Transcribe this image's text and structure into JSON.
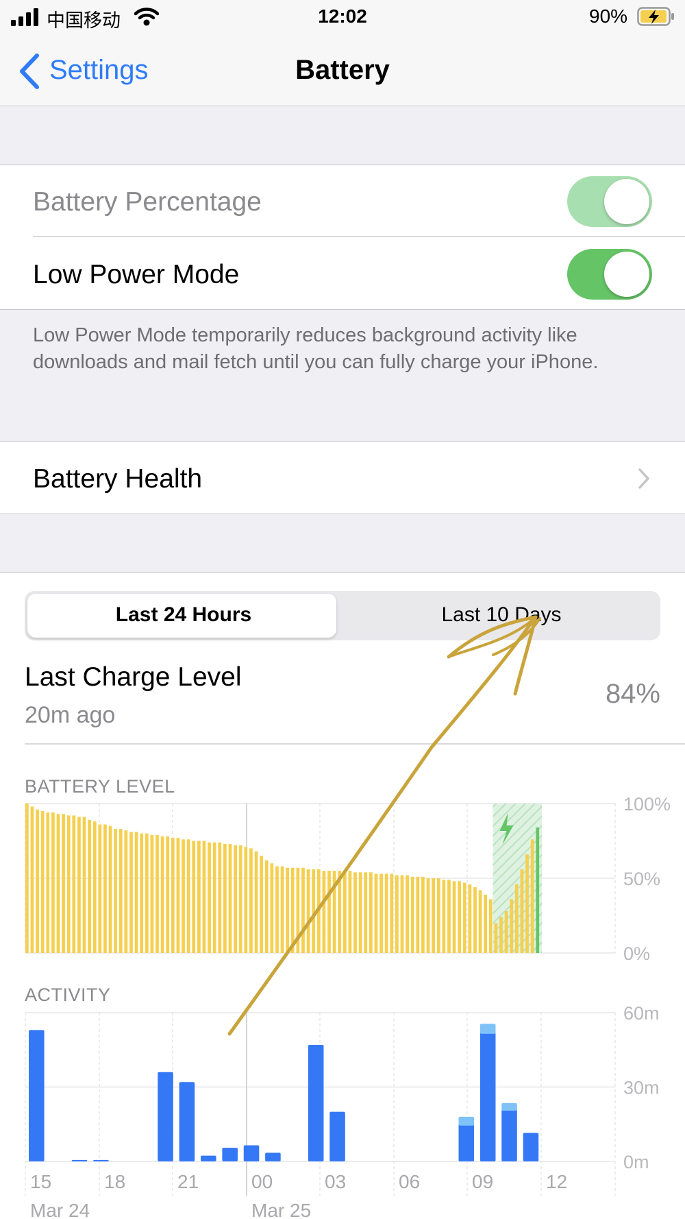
{
  "status": {
    "carrier": "中国移动",
    "time": "12:02",
    "battery_percent": "90%"
  },
  "nav": {
    "back_label": "Settings",
    "title": "Battery"
  },
  "settings": {
    "battery_percentage_label": "Battery Percentage",
    "low_power_label": "Low Power Mode",
    "low_power_note": "Low Power Mode temporarily reduces background activity like downloads and mail fetch until you can fully charge your iPhone.",
    "battery_health_label": "Battery Health",
    "battery_percentage_on": true,
    "low_power_on": true
  },
  "usage": {
    "tabs": [
      "Last 24 Hours",
      "Last 10 Days"
    ],
    "selected_tab": 0,
    "last_charge_title": "Last Charge Level",
    "last_charge_time": "20m ago",
    "last_charge_value": "84%",
    "battery_level_caption": "BATTERY LEVEL",
    "activity_caption": "ACTIVITY"
  },
  "colors": {
    "accent": "#2f7cf6",
    "toggle_on": "#65c466",
    "toggle_dim": "#a8dfb0",
    "battery_bar": "#f5cf4f",
    "charging_bar": "#65c466",
    "activity_bar": "#3478f6",
    "activity_light": "#7ec2f7",
    "annotation": "#c9a43b"
  },
  "chart_data": [
    {
      "type": "bar",
      "title": "BATTERY LEVEL",
      "y_ticks": [
        "100%",
        "50%",
        "0%"
      ],
      "ylim": [
        0,
        100
      ],
      "unit": "%",
      "values": [
        100,
        98,
        96,
        95,
        94,
        94,
        93,
        93,
        92,
        92,
        91,
        91,
        89,
        88,
        86,
        86,
        85,
        83,
        83,
        82,
        81,
        81,
        80,
        80,
        79,
        79,
        78,
        78,
        77,
        77,
        76,
        76,
        75,
        75,
        75,
        74,
        74,
        74,
        73,
        73,
        72,
        72,
        71,
        70,
        68,
        65,
        62,
        60,
        58,
        58,
        57,
        57,
        57,
        57,
        56,
        56,
        56,
        55,
        55,
        55,
        55,
        55,
        55,
        54,
        54,
        54,
        54,
        53,
        53,
        53,
        53,
        52,
        52,
        52,
        51,
        51,
        51,
        50,
        50,
        50,
        49,
        49,
        48,
        48,
        47,
        46,
        44,
        42,
        39,
        36
      ],
      "charging_values": [
        20,
        24,
        28,
        36,
        46,
        56,
        66,
        76,
        84
      ],
      "charging_indicator": true
    },
    {
      "type": "bar",
      "title": "ACTIVITY",
      "y_ticks": [
        "60m",
        "30m",
        "0m"
      ],
      "ylim": [
        0,
        60
      ],
      "unit": "minutes",
      "x_ticks": [
        "15",
        "18",
        "21",
        "00",
        "03",
        "06",
        "09",
        "12"
      ],
      "date_labels": [
        "Mar 24",
        "Mar 25"
      ],
      "series": [
        {
          "values": [
            53,
            0.6,
            0.6,
            0,
            36,
            32,
            2.3,
            5.5,
            6.5,
            3.5,
            0,
            47,
            20,
            0,
            0,
            0,
            0,
            0,
            15,
            52,
            21,
            11.5
          ]
        },
        {
          "values": [
            0,
            0,
            0,
            0,
            0,
            0,
            0,
            0,
            0,
            0,
            0,
            0,
            0,
            0,
            0,
            0,
            0,
            0,
            3,
            3.5,
            2.5,
            0
          ]
        }
      ],
      "slots": [
        0,
        2,
        3,
        4,
        6,
        7,
        8,
        9,
        10,
        11,
        12,
        13,
        14,
        15,
        16,
        17,
        18,
        19,
        20,
        21,
        22,
        23
      ]
    }
  ]
}
